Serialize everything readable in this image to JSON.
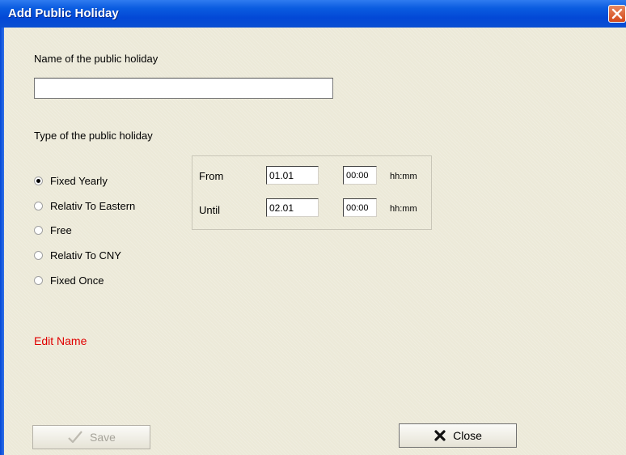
{
  "window": {
    "title": "Add Public Holiday"
  },
  "name_field": {
    "label": "Name of the public holiday",
    "value": ""
  },
  "type": {
    "label": "Type of the public holiday",
    "options": [
      {
        "label": "Fixed Yearly",
        "checked": true
      },
      {
        "label": "Relativ To Eastern",
        "checked": false
      },
      {
        "label": "Free",
        "checked": false
      },
      {
        "label": "Relativ To CNY",
        "checked": false
      },
      {
        "label": "Fixed Once",
        "checked": false
      }
    ]
  },
  "range": {
    "from_label": "From",
    "from_date": "01.01",
    "from_time": "00:00",
    "until_label": "Until",
    "until_date": "02.01",
    "until_time": "00:00",
    "time_unit": "hh:mm"
  },
  "status": {
    "text": "Edit Name",
    "color": "#e00000"
  },
  "buttons": {
    "save": "Save",
    "close": "Close"
  },
  "colors": {
    "titlebar": "#0348d6",
    "background": "#ece9d8"
  }
}
